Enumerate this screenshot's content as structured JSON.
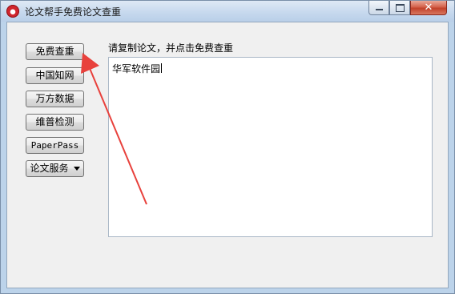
{
  "window": {
    "title": "论文帮手免费论文查重",
    "app_icon": "red-drop-icon",
    "controls": {
      "minimize_icon": "minimize-icon",
      "maximize_icon": "maximize-icon",
      "close_icon": "close-icon",
      "close_glyph": "✕"
    }
  },
  "sidebar": {
    "buttons": [
      {
        "label": "免费查重"
      },
      {
        "label": "中国知网"
      },
      {
        "label": "万方数据"
      },
      {
        "label": "维普检测"
      },
      {
        "label": "PaperPass"
      },
      {
        "label": "论文服务"
      }
    ]
  },
  "main": {
    "prompt": "请复制论文，并点击免费查重",
    "text_value": "华军软件园"
  },
  "annotation": {
    "arrow_color": "#e8413c"
  }
}
